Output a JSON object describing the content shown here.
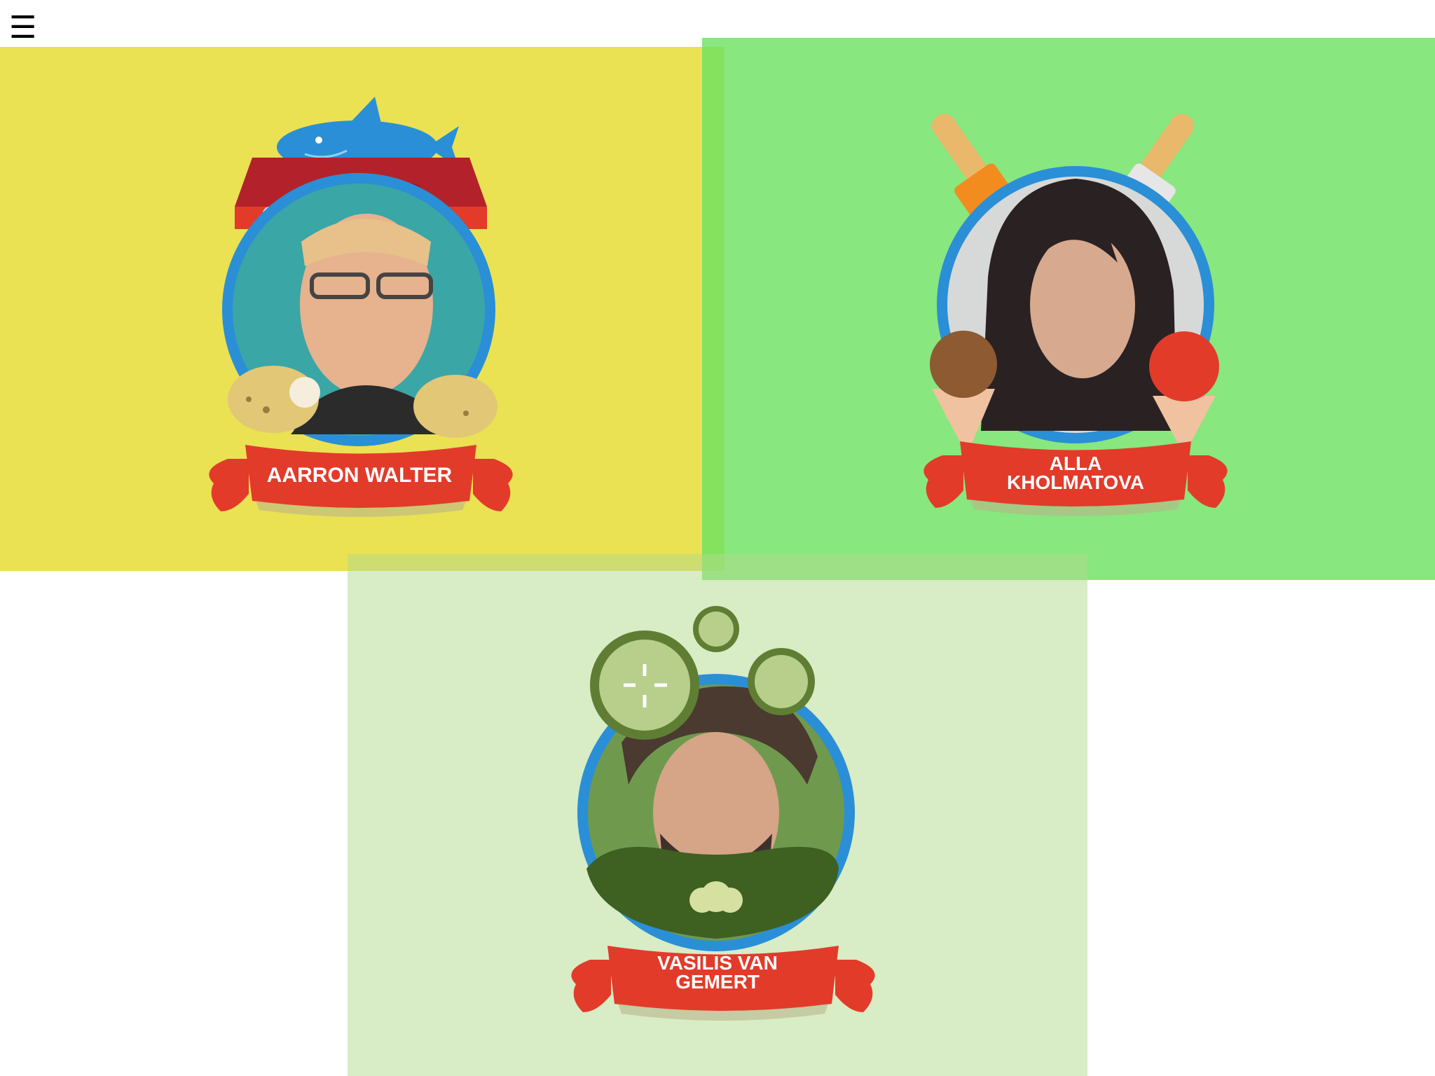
{
  "nav": {
    "menu_icon": "hamburger-menu-icon",
    "menu_glyph": "☰"
  },
  "colors": {
    "yellow_panel": "#ebe054",
    "green_panel": "#7ee46a",
    "pale_green_panel": "#d7edc4",
    "ring_blue": "#2a8fd6",
    "ribbon_red": "#e23b2a",
    "awning_red": "#b3222a"
  },
  "speakers": [
    {
      "name_lines": [
        "AARRON WALTER"
      ],
      "theme_icon": "fish-market-icon",
      "food_icon": "potato-icon"
    },
    {
      "name_lines": [
        "ALLA",
        "KHOLMATOVA"
      ],
      "theme_icon": "popsicle-icon",
      "food_icon": "ice-cream-cone-icon"
    },
    {
      "name_lines": [
        "VASILIS VAN",
        "GEMERT"
      ],
      "theme_icon": "cucumber-slice-icon",
      "food_icon": "pickle-icon"
    }
  ]
}
